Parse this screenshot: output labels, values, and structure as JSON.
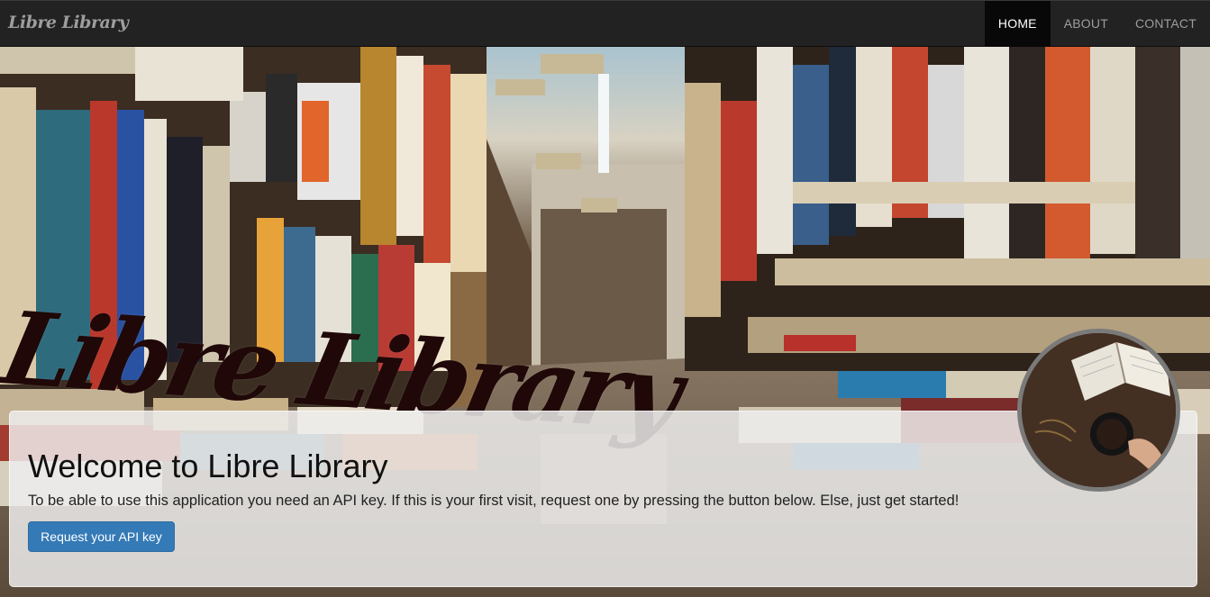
{
  "navbar": {
    "brand": "Libre Library",
    "items": [
      {
        "label": "HOME",
        "active": true
      },
      {
        "label": "ABOUT",
        "active": false
      },
      {
        "label": "CONTACT",
        "active": false
      }
    ]
  },
  "hero": {
    "title_art": "Libre Library"
  },
  "welcome": {
    "heading": "Welcome to Libre Library",
    "text": "To be able to use this application you need an API key. If this is your first visit, request one by pressing the button below. Else, just get started!",
    "button_label": "Request your API key"
  },
  "colors": {
    "navbar_bg": "#222222",
    "nav_active_bg": "#080808",
    "button_primary": "#337ab7",
    "title_color": "#200808"
  },
  "icons": {
    "avatar": "open-book-coffee-image"
  }
}
